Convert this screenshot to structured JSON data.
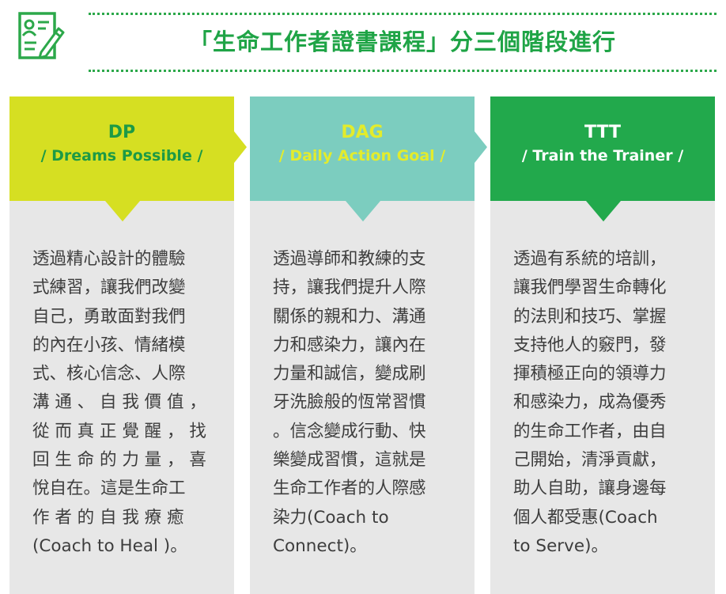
{
  "header": {
    "title": "「生命工作者證書課程」分三個階段進行",
    "icon": "certificate-icon"
  },
  "colors": {
    "accent_green": "#1fa446",
    "dp": "#d6df22",
    "dag": "#7ccdbf",
    "ttt": "#22a94c",
    "panel": "#e7e7e7"
  },
  "stages": [
    {
      "name": "DP",
      "subtitle": "/ Dreams Possible /",
      "lines": [
        "透過精心設計的體驗",
        "式練習，讓我們改變",
        "自己，勇敢面對我們",
        "的內在小孩、情緒模",
        "式、核心信念、人際",
        "溝 通 、 自 我 價 值 ，",
        "從 而 真 正 覺 醒 ， 找",
        "回 生 命 的 力 量 ， 喜",
        "悅自在。這是生命工",
        "作 者 的 自 我 療 癒",
        "(Coach to Heal )。"
      ]
    },
    {
      "name": "DAG",
      "subtitle": "/ Daily Action Goal /",
      "lines": [
        "透過導師和教練的支",
        "持，讓我們提升人際",
        "關係的親和力、溝通",
        "力和感染力，讓內在",
        "力量和誠信，變成刷",
        "牙洗臉般的恆常習慣",
        "。信念變成行動、快",
        "樂變成習慣，這就是",
        "生命工作者的人際感",
        "染力(Coach to",
        "Connect)。"
      ]
    },
    {
      "name": "TTT",
      "subtitle": "/ Train the Trainer /",
      "lines": [
        "透過有系統的培訓，",
        "讓我們學習生命轉化",
        "的法則和技巧、掌握",
        "支持他人的竅門，發",
        "揮積極正向的領導力",
        "和感染力，成為優秀",
        "的生命工作者，由自",
        "己開始，清淨貢獻，",
        "助人自助，讓身邊每",
        "個人都受惠(Coach",
        "to Serve)。"
      ]
    }
  ]
}
